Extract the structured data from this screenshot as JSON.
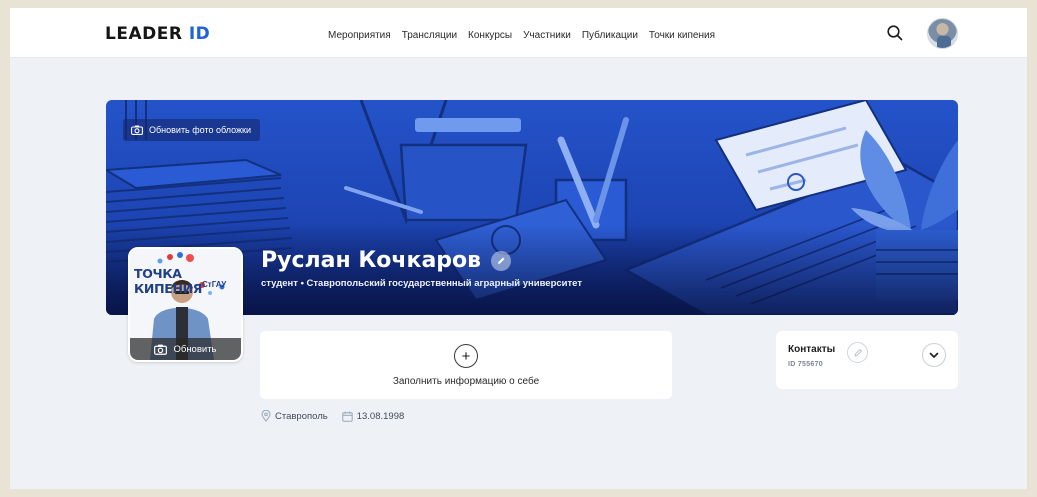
{
  "header": {
    "logo_main": "LEADER",
    "logo_accent": "ID",
    "nav": [
      "Мероприятия",
      "Трансляции",
      "Конкурсы",
      "Участники",
      "Публикации",
      "Точки кипения"
    ]
  },
  "cover": {
    "update_cover_label": "Обновить фото обложки"
  },
  "profile": {
    "name": "Руслан Кочкаров",
    "subtitle": "студент • Ставропольский государственный аграрный университет",
    "photo_update_label": "Обновить",
    "photo_brand_text": "ТОЧКА КИПЕНИЯ",
    "photo_brand_sub": "СтГАУ"
  },
  "info_card": {
    "plus_glyph": "+",
    "label": "Заполнить информацию о себе"
  },
  "contacts": {
    "title": "Контакты",
    "id_text": "ID 755670"
  },
  "meta": {
    "city": "Ставрополь",
    "birth_date": "13.08.1998"
  },
  "colors": {
    "accent": "#1f63d8",
    "cover_blue": "#2453c9",
    "page_bg": "#eef2f7"
  }
}
